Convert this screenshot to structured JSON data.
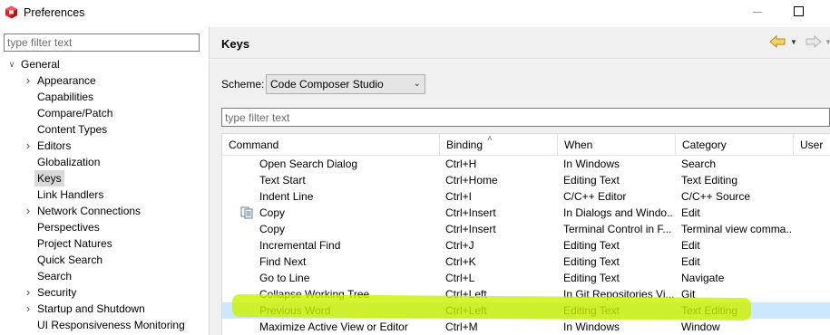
{
  "window": {
    "title": "Preferences",
    "icon": "ccs-cube-icon",
    "accent_color": "#cc2222"
  },
  "left": {
    "filter_placeholder": "type filter text",
    "tree": [
      {
        "label": "General",
        "level": 0,
        "expanded": true,
        "has_children": true,
        "selected": false
      },
      {
        "label": "Appearance",
        "level": 1,
        "has_children": true,
        "selected": false
      },
      {
        "label": "Capabilities",
        "level": 1,
        "has_children": false,
        "selected": false
      },
      {
        "label": "Compare/Patch",
        "level": 1,
        "has_children": false,
        "selected": false
      },
      {
        "label": "Content Types",
        "level": 1,
        "has_children": false,
        "selected": false
      },
      {
        "label": "Editors",
        "level": 1,
        "has_children": true,
        "selected": false
      },
      {
        "label": "Globalization",
        "level": 1,
        "has_children": false,
        "selected": false
      },
      {
        "label": "Keys",
        "level": 1,
        "has_children": false,
        "selected": true
      },
      {
        "label": "Link Handlers",
        "level": 1,
        "has_children": false,
        "selected": false
      },
      {
        "label": "Network Connections",
        "level": 1,
        "has_children": true,
        "selected": false
      },
      {
        "label": "Perspectives",
        "level": 1,
        "has_children": false,
        "selected": false
      },
      {
        "label": "Project Natures",
        "level": 1,
        "has_children": false,
        "selected": false
      },
      {
        "label": "Quick Search",
        "level": 1,
        "has_children": false,
        "selected": false
      },
      {
        "label": "Search",
        "level": 1,
        "has_children": false,
        "selected": false
      },
      {
        "label": "Security",
        "level": 1,
        "has_children": true,
        "selected": false
      },
      {
        "label": "Startup and Shutdown",
        "level": 1,
        "has_children": true,
        "selected": false
      },
      {
        "label": "UI Responsiveness Monitoring",
        "level": 1,
        "has_children": false,
        "selected": false
      }
    ]
  },
  "right": {
    "title": "Keys",
    "scheme_label": "Scheme:",
    "scheme_value": "Code Composer Studio",
    "filter_placeholder": "type filter text",
    "columns": [
      "Command",
      "Binding",
      "When",
      "Category",
      "User"
    ],
    "rows": [
      {
        "command": "Open Search Dialog",
        "binding": "Ctrl+H",
        "when": "In Windows",
        "category": "Search",
        "user": "",
        "icon": false,
        "selected": false
      },
      {
        "command": "Text Start",
        "binding": "Ctrl+Home",
        "when": "Editing Text",
        "category": "Text Editing",
        "user": "",
        "icon": false,
        "selected": false
      },
      {
        "command": "Indent Line",
        "binding": "Ctrl+I",
        "when": "C/C++ Editor",
        "category": "C/C++ Source",
        "user": "",
        "icon": false,
        "selected": false
      },
      {
        "command": "Copy",
        "binding": "Ctrl+Insert",
        "when": "In Dialogs and Windo...",
        "category": "Edit",
        "user": "",
        "icon": true,
        "selected": false
      },
      {
        "command": "Copy",
        "binding": "Ctrl+Insert",
        "when": "Terminal Control in F...",
        "category": "Terminal view comma...",
        "user": "",
        "icon": false,
        "selected": false
      },
      {
        "command": "Incremental Find",
        "binding": "Ctrl+J",
        "when": "Editing Text",
        "category": "Edit",
        "user": "",
        "icon": false,
        "selected": false
      },
      {
        "command": "Find Next",
        "binding": "Ctrl+K",
        "when": "Editing Text",
        "category": "Edit",
        "user": "",
        "icon": false,
        "selected": false
      },
      {
        "command": "Go to Line",
        "binding": "Ctrl+L",
        "when": "Editing Text",
        "category": "Navigate",
        "user": "",
        "icon": false,
        "selected": false
      },
      {
        "command": "Collapse Working Tree",
        "binding": "Ctrl+Left",
        "when": "In Git Repositories Vi...",
        "category": "Git",
        "user": "",
        "icon": false,
        "selected": false
      },
      {
        "command": "Previous Word",
        "binding": "Ctrl+Left",
        "when": "Editing Text",
        "category": "Text Editing",
        "user": "",
        "icon": false,
        "selected": true
      },
      {
        "command": "Maximize Active View or Editor",
        "binding": "Ctrl+M",
        "when": "In Windows",
        "category": "Window",
        "user": "",
        "icon": false,
        "selected": false
      }
    ],
    "highlight_color": "#ccf000"
  }
}
